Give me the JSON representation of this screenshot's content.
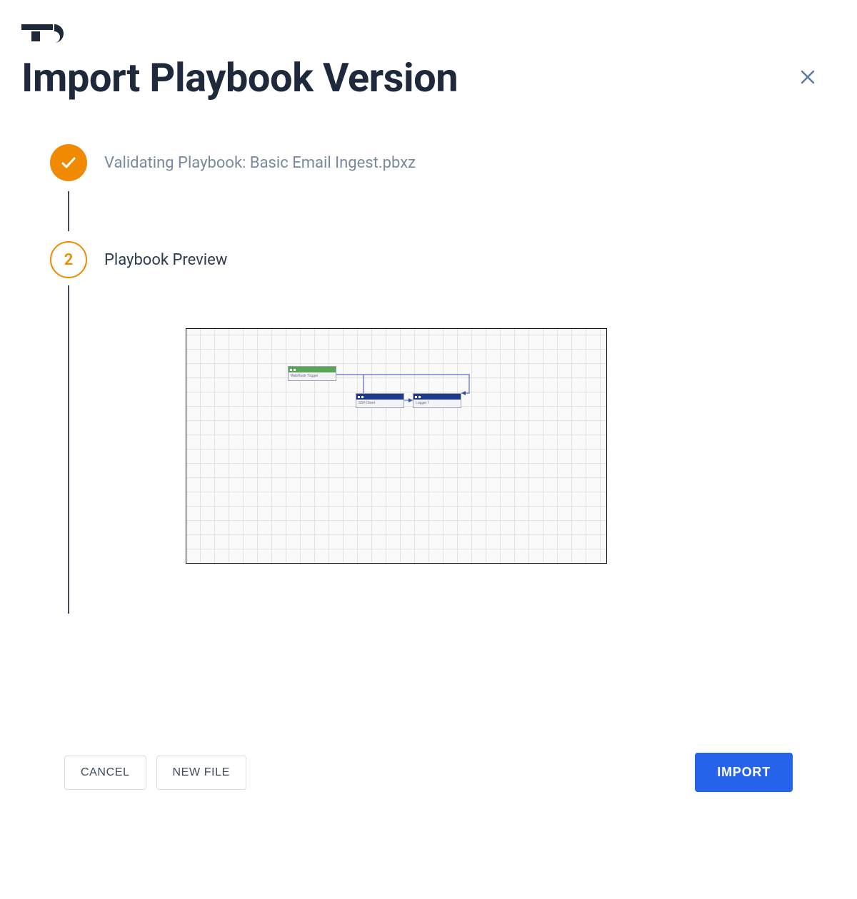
{
  "header": {
    "title": "Import Playbook Version"
  },
  "steps": {
    "step1": {
      "label": "Validating Playbook: Basic Email Ingest.pbxz"
    },
    "step2": {
      "number": "2",
      "label": "Playbook Preview"
    }
  },
  "preview": {
    "nodes": {
      "trigger": "WebHook Trigger",
      "client": "SSH Client",
      "logger": "Logger 1"
    }
  },
  "footer": {
    "cancel": "CANCEL",
    "newfile": "NEW FILE",
    "import": "IMPORT"
  }
}
